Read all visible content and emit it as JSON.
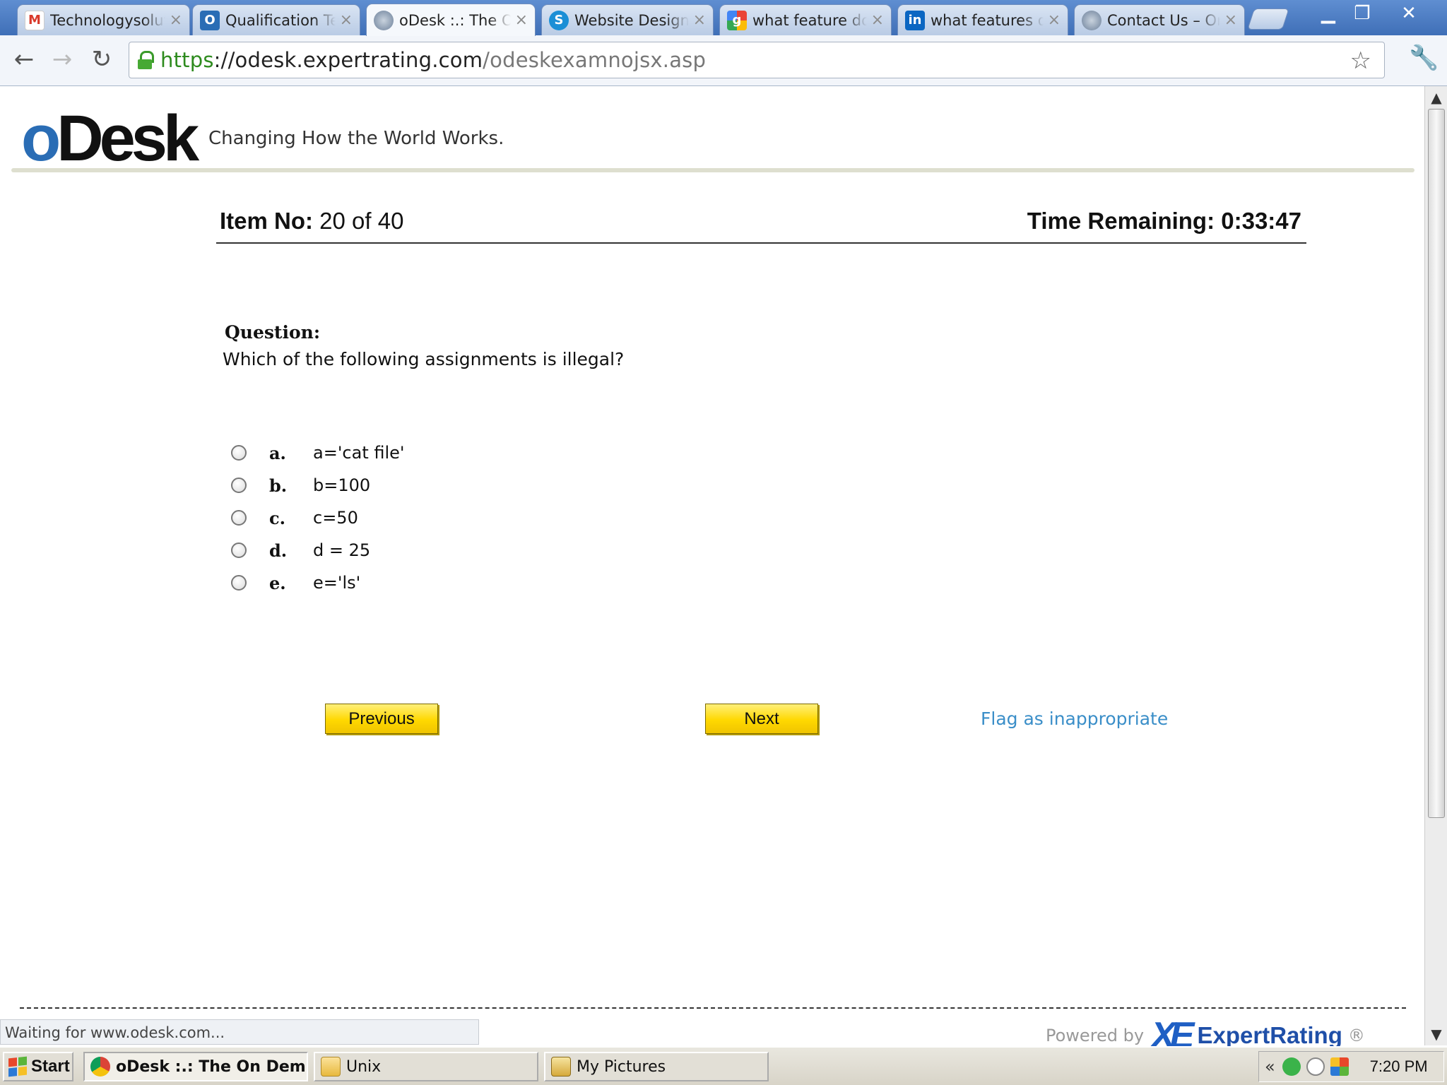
{
  "browser": {
    "tabs": [
      {
        "title": "Technologysolut",
        "icon": "gmail-icon",
        "color": "#d93a2b"
      },
      {
        "title": "Qualification Tes",
        "icon": "odesk-o-icon",
        "color": "#2a6db5"
      },
      {
        "title": "oDesk :.: The O",
        "icon": "globe-icon",
        "color": "#6b7f99",
        "active": true
      },
      {
        "title": "Website Design,",
        "icon": "skype-icon",
        "color": "#1b8fd6"
      },
      {
        "title": "what feature do",
        "icon": "google-icon",
        "color": "#3b78e7"
      },
      {
        "title": "what features d",
        "icon": "linkedin-icon",
        "color": "#0a66c2"
      },
      {
        "title": "Contact Us – Or",
        "icon": "globe-icon",
        "color": "#6b7f99"
      }
    ],
    "url_scheme": "https",
    "url_host": "://odesk.expertrating.com",
    "url_path": "/odeskexamnojsx.asp",
    "status_text": "Waiting for www.odesk.com..."
  },
  "header": {
    "logo_o": "o",
    "logo_rest": "Desk",
    "tagline": "Changing How the World Works."
  },
  "exam": {
    "item_label": "Item No:",
    "item_value": "20 of 40",
    "time_label": "Time Remaining:",
    "time_value": "0:33:47",
    "question_label": "Question:",
    "question_text": "Which of the following assignments is illegal?",
    "options": [
      {
        "letter": "a.",
        "text": "a='cat file'"
      },
      {
        "letter": "b.",
        "text": "b=100"
      },
      {
        "letter": "c.",
        "text": "c=50"
      },
      {
        "letter": "d.",
        "text": "d = 25"
      },
      {
        "letter": "e.",
        "text": "e='ls'"
      }
    ],
    "prev_label": "Previous",
    "next_label": "Next",
    "flag_label": "Flag as inappropriate"
  },
  "footer": {
    "powered_by": "Powered by",
    "brand": "ExpertRating",
    "reg": "®"
  },
  "taskbar": {
    "start_label": "Start",
    "tasks": [
      {
        "label": "oDesk :.: The On Dem...",
        "icon": "chrome-icon",
        "active": true
      },
      {
        "label": "Unix",
        "icon": "folder-icon"
      },
      {
        "label": "My Pictures",
        "icon": "pictures-icon"
      }
    ],
    "chevron": "«",
    "clock": "7:20 PM"
  },
  "colors": {
    "accent_blue": "#2a6db5",
    "button_yellow": "#ffd800",
    "link_blue": "#3a8ec8",
    "url_green": "#2e8b1e"
  }
}
